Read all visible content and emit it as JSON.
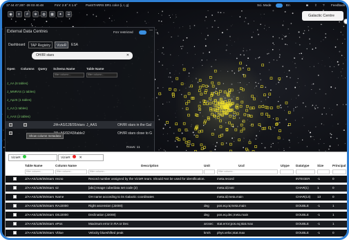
{
  "topbar": {
    "coords": "17 44 47.287 -28 03 40.48",
    "fov": "FoV: 2.5° X 1.6°",
    "survey": "PanSTARRS DR1 color (i, r, g)",
    "sci_mode": "Sci. Mode",
    "lang": "En",
    "user": "Feedback"
  },
  "target": "Galactic Centre",
  "panel": {
    "title": "External Data Centres",
    "fov_restricted": "FoV restricted",
    "tabs": [
      "Dashboard",
      "TAP Registry",
      "VizieR",
      "ESA"
    ],
    "search": "OH/IR stars",
    "columns": [
      "Open",
      "Columns",
      "Query",
      "Schema Name",
      "Table Name"
    ],
    "filter": "filter column...",
    "tree": [
      {
        "label": "J_AA (6 tables)"
      },
      {
        "label": "J_MNRAS (1 tables)"
      },
      {
        "label": "J_ApJS (1 tables)"
      },
      {
        "label": "J_AJ (1 tables)"
      },
      {
        "label": "J_AAS (2 tables)"
      }
    ],
    "rows": [
      {
        "schema": "J/A+AS/128/35/stars",
        "table": "J_AAS",
        "desc": "OH/IR stars in the Gal"
      },
      {
        "schema": "J/A+AS/92/43/table2",
        "table": "",
        "desc": "OH/IR stars close to G"
      }
    ],
    "tooltip": "Show column metadata",
    "rowcount": "Rows: 11"
  },
  "lower": {
    "tabs": [
      "VizieR",
      "VizieR"
    ],
    "headers": [
      "",
      "Table Name",
      "Column Name",
      "Description",
      "Unit",
      "Ucd",
      "Utype",
      "Datatype",
      "Size",
      "Principal"
    ],
    "filter": "filter column...",
    "rows": [
      {
        "table": "J/A+AS/128/35/stars",
        "col": "recno",
        "desc": "Record number assigned by the VizieR team. Should Not be used for identification.",
        "unit": "",
        "ucd": "meta.record",
        "dtype": "INTEGER",
        "size": "-1",
        "pr": "0"
      },
      {
        "table": "J/A+AS/128/35/stars",
        "col": "s2",
        "desc": "[abc] Image cube/data set code (2)",
        "unit": "",
        "ucd": "meta.id;instr",
        "dtype": "CHAR(1)",
        "size": "1",
        "pr": "0"
      },
      {
        "table": "J/A+AS/128/35/stars",
        "col": "Name",
        "desc": "OH name according to its Galactic coordinates",
        "unit": "",
        "ucd": "meta.id;meta.main",
        "dtype": "CHAR(13)",
        "size": "13",
        "pr": "0"
      },
      {
        "table": "J/A+AS/128/35/stars",
        "col": "RAJ2000",
        "desc": "Right ascension (J2000)",
        "unit": "deg",
        "ucd": "pos.eq.ra;meta.main",
        "dtype": "DOUBLE",
        "size": "-1",
        "pr": "1"
      },
      {
        "table": "J/A+AS/128/35/stars",
        "col": "DEJ2000",
        "desc": "Declination (J2000)",
        "unit": "deg",
        "ucd": "pos.eq.dec;meta.main",
        "dtype": "DOUBLE",
        "size": "-1",
        "pr": "1"
      },
      {
        "table": "J/A+AS/128/35/stars",
        "col": "ePos",
        "desc": "Maximum error in RA or Dec",
        "unit": "arcsec",
        "ucd": "stat.error;pos.eq;stat.max",
        "dtype": "DOUBLE",
        "size": "-1",
        "pr": "1"
      },
      {
        "table": "J/A+AS/128/35/stars",
        "col": "Vblue",
        "desc": "Velocity blueshifted peak",
        "unit": "km/s",
        "ucd": "phys.veloc;stat.max",
        "dtype": "DOUBLE",
        "size": "-1",
        "pr": "0"
      }
    ]
  }
}
